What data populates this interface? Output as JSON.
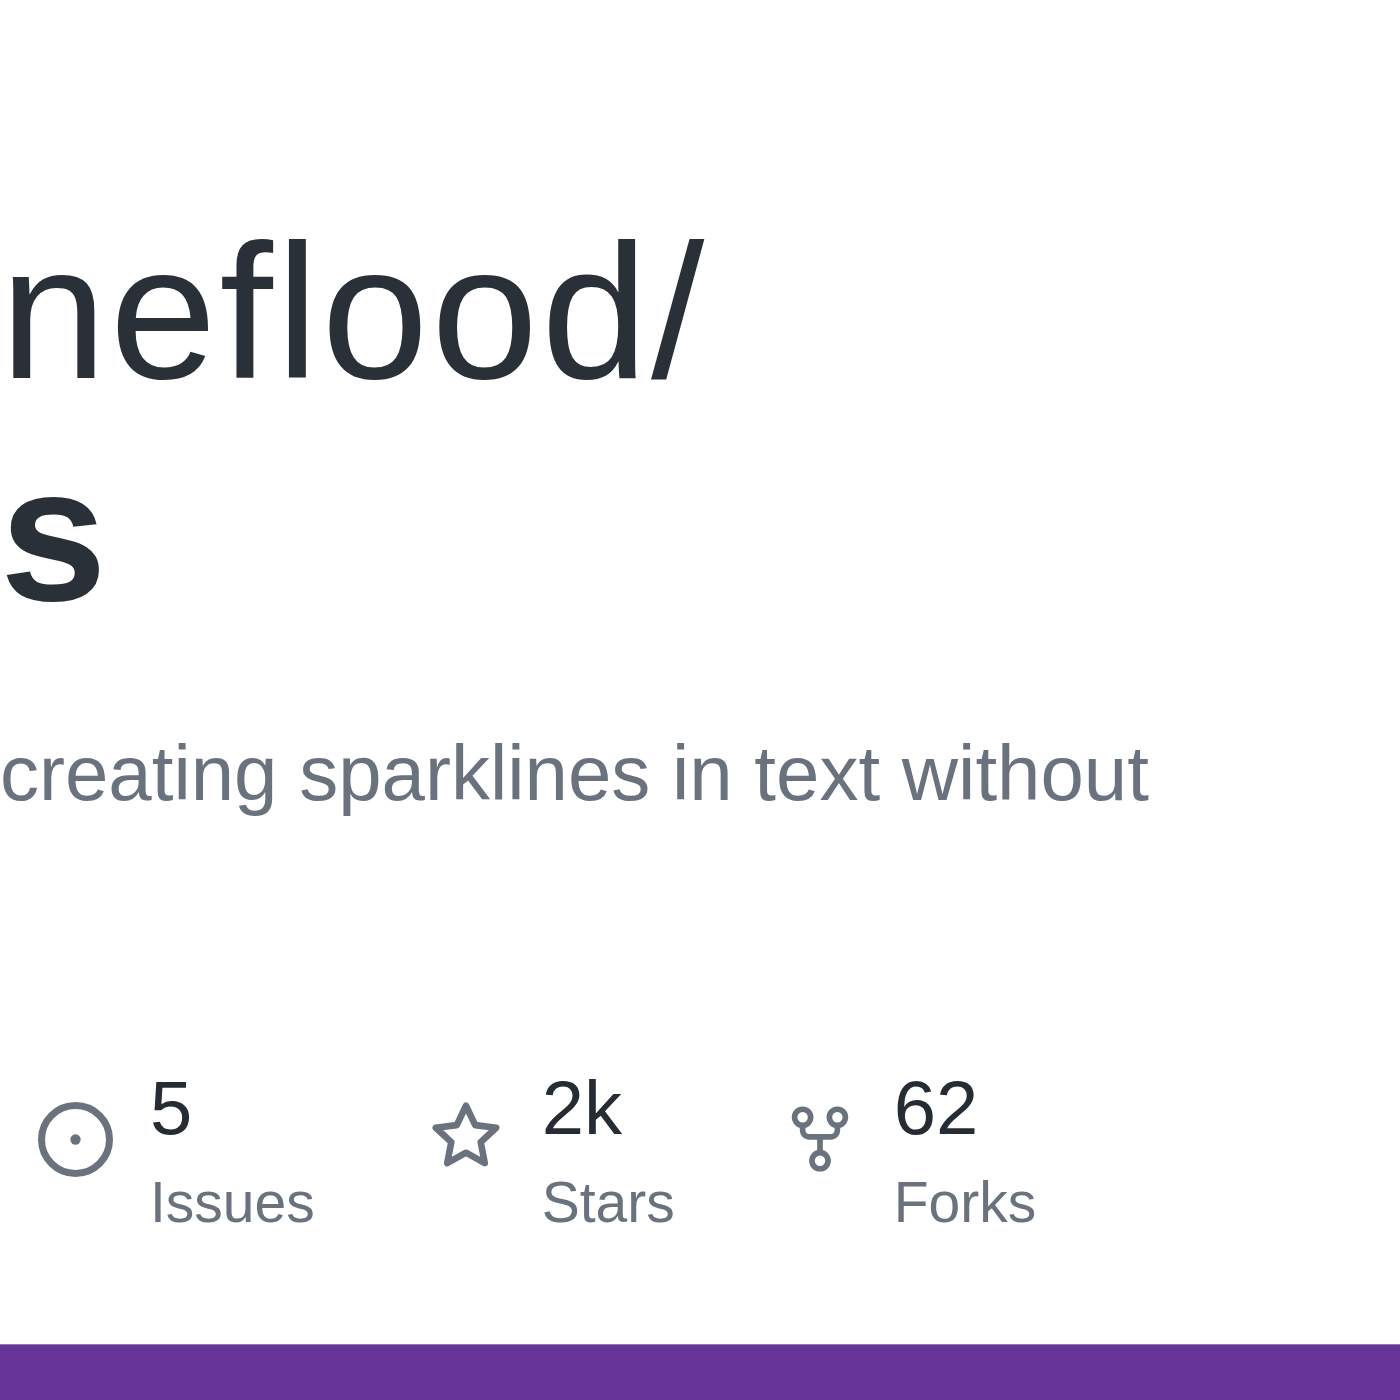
{
  "title": {
    "owner": "neflood/",
    "repo": "s"
  },
  "description": "creating sparklines in text without",
  "stats": [
    {
      "kind": "issues",
      "count": "5",
      "label": "Issues"
    },
    {
      "kind": "stars",
      "count": "2k",
      "label": "Stars"
    },
    {
      "kind": "forks",
      "count": "62",
      "label": "Forks"
    }
  ]
}
